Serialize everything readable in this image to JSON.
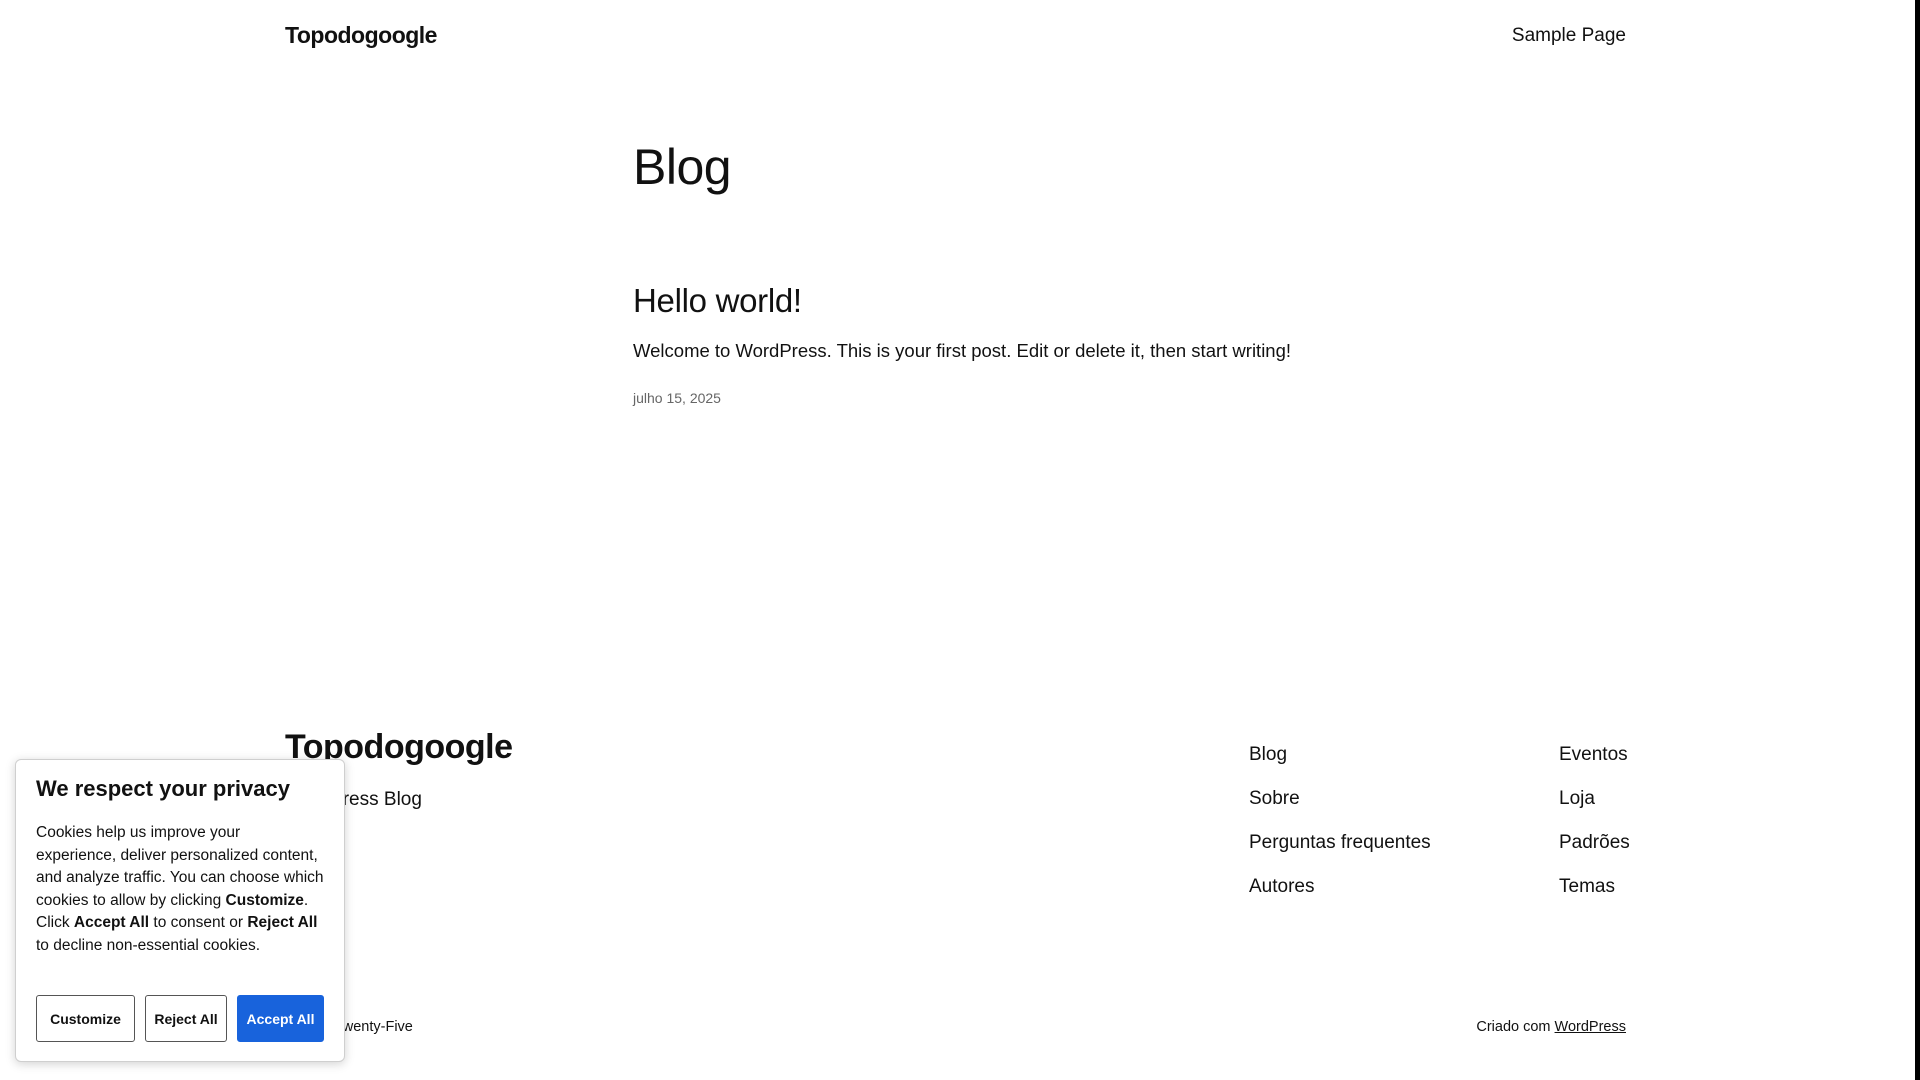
{
  "header": {
    "site_title": "Topodogoogle",
    "nav": [
      "Sample Page"
    ]
  },
  "main": {
    "heading": "Blog",
    "post": {
      "title": "Hello world!",
      "excerpt": "Welcome to WordPress. This is your first post. Edit or delete it, then start writing!",
      "date": "julho 15, 2025"
    }
  },
  "footer": {
    "site_title": "Topodogoogle",
    "tagline": "WordPress Blog",
    "column_1": [
      "Blog",
      "Sobre",
      "Perguntas frequentes",
      "Autores"
    ],
    "column_2": [
      "Eventos",
      "Loja",
      "Padrões",
      "Temas"
    ],
    "credit_left": "Twenty Twenty-Five",
    "credit_right_prefix": "Criado com",
    "credit_right_link": "WordPress"
  },
  "cookie_banner": {
    "title": "We respect your privacy",
    "text_1": "Cookies help us improve your experience, deliver personalized content, and analyze traffic. You can choose which cookies to allow by clicking ",
    "bold_customize": "Customize",
    "text_2": ". Click ",
    "bold_accept": "Accept All",
    "text_3": " to consent or ",
    "bold_reject": "Reject All",
    "text_4": " to decline non-essential cookies.",
    "buttons": {
      "customize": "Customize",
      "reject": "Reject All",
      "accept": "Accept All"
    },
    "accent_color": "#1863dc"
  }
}
